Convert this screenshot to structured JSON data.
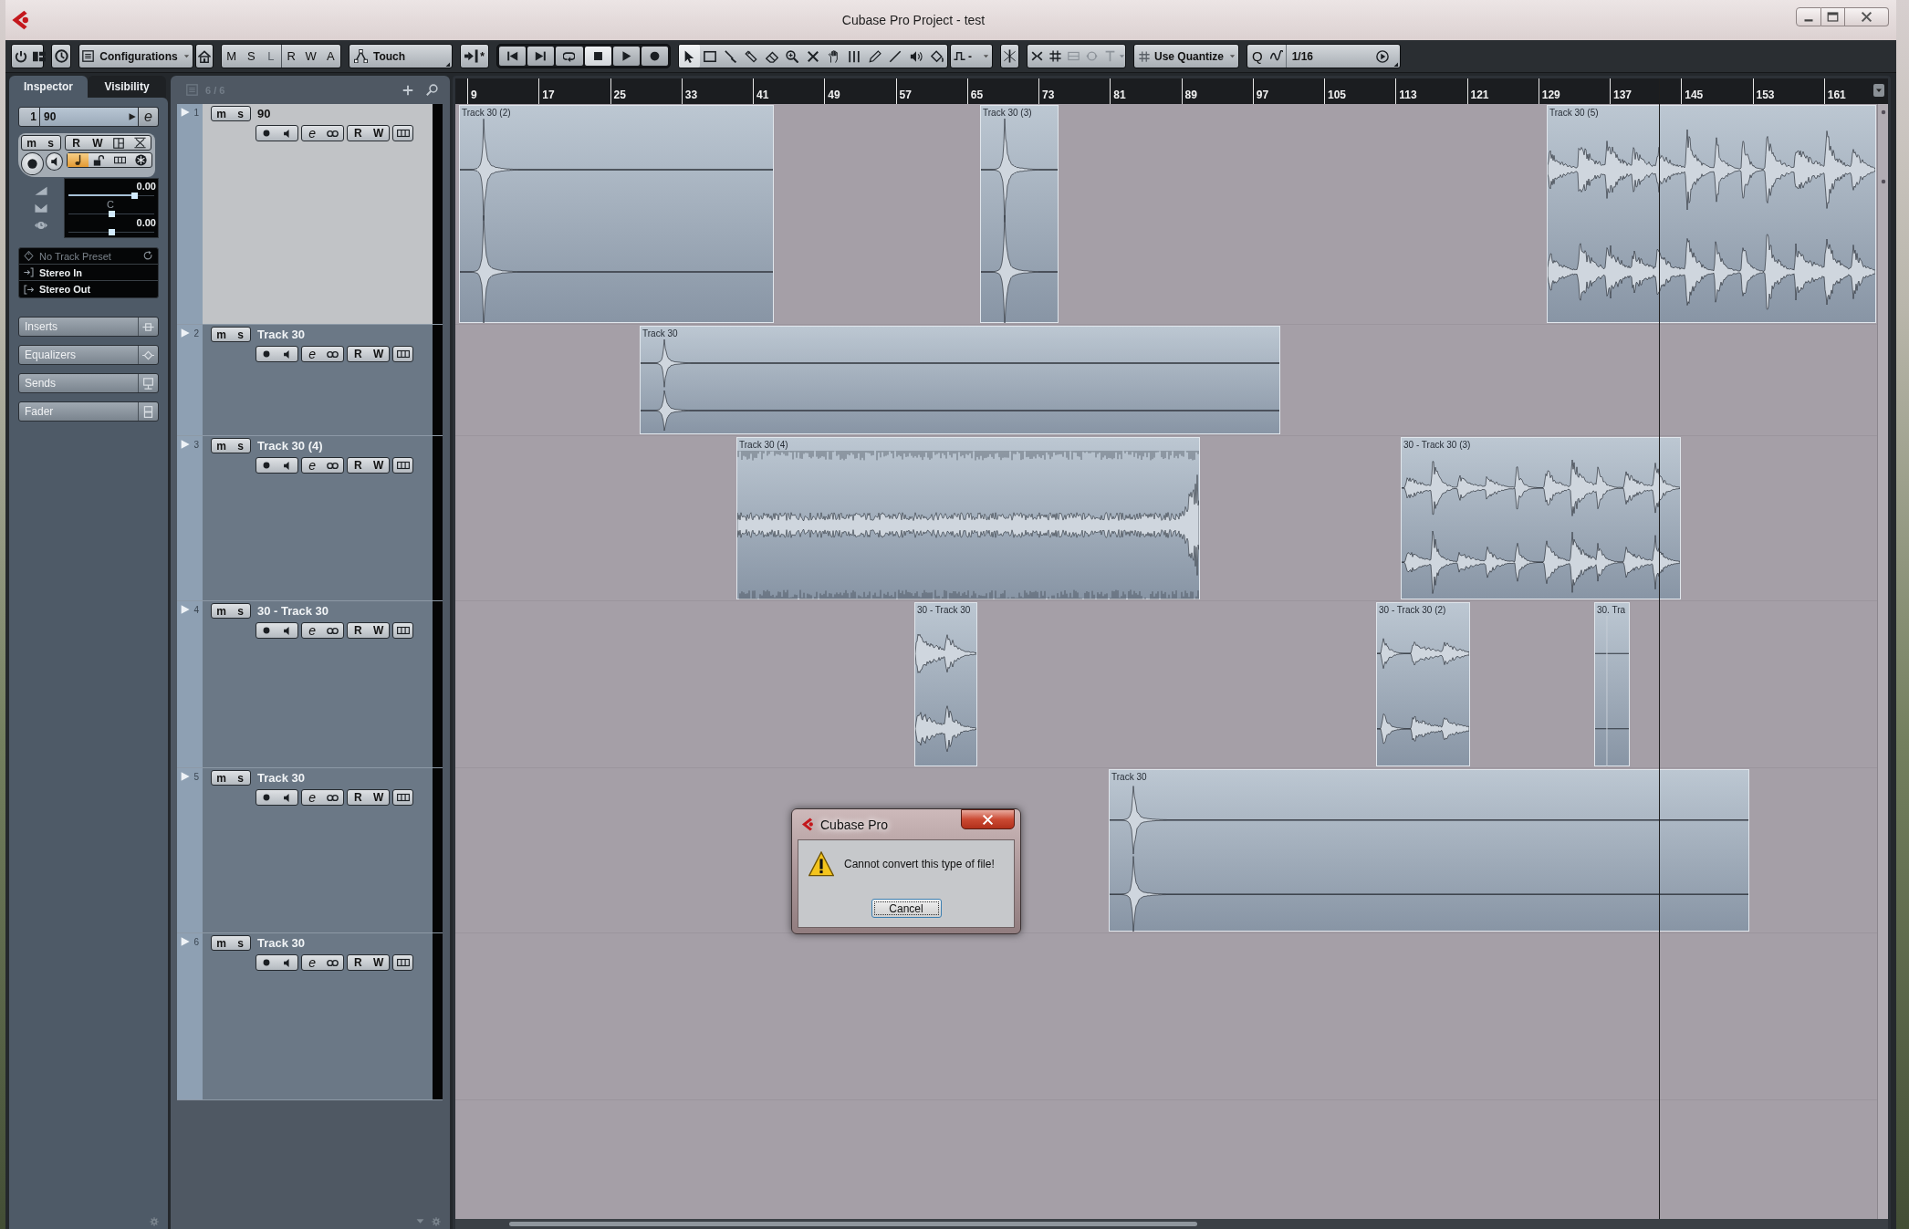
{
  "window": {
    "title": "Cubase Pro Project - test"
  },
  "toolbar": {
    "configurations": "Configurations",
    "global_buttons": [
      {
        "label": "M",
        "disabled": false
      },
      {
        "label": "S",
        "disabled": false
      },
      {
        "label": "L",
        "disabled": true
      },
      {
        "label": "R",
        "disabled": false
      },
      {
        "label": "W",
        "disabled": false
      },
      {
        "label": "A",
        "disabled": false
      }
    ],
    "automation_mode": "Touch",
    "snap_mark": "*",
    "transport": [
      {
        "on": false
      },
      {
        "on": false
      },
      {
        "on": false
      },
      {
        "on": true
      },
      {
        "on": false
      },
      {
        "on": false
      }
    ],
    "tools": [
      {
        "selected": true
      },
      {
        "selected": false
      },
      {
        "selected": false
      },
      {
        "selected": false
      },
      {
        "selected": false
      },
      {
        "selected": false
      },
      {
        "selected": false
      },
      {
        "selected": false
      },
      {
        "selected": false
      },
      {
        "selected": false
      },
      {
        "selected": false
      },
      {
        "selected": false
      },
      {
        "selected": false
      }
    ],
    "field_value": "-",
    "quantize_preset": "Use Quantize",
    "quantize_label": "Q",
    "quantize_value": "1/16"
  },
  "inspector": {
    "tabs": [
      {
        "label": "Inspector",
        "selected": true
      },
      {
        "label": "Visibility",
        "selected": false
      }
    ],
    "track_number": "1",
    "track_name": "90",
    "edit_label": "e",
    "mute_label": "m",
    "solo_label": "s",
    "read_label": "R",
    "write_label": "W",
    "toggles": [
      {
        "on": true
      },
      {
        "on": false
      },
      {
        "on": false
      },
      {
        "on": false
      }
    ],
    "controls": [
      {
        "kind": "volume",
        "reading": "0.00",
        "level": 0.77
      },
      {
        "kind": "pan",
        "reading": "C",
        "level": 0.5
      },
      {
        "kind": "delay",
        "reading": "0.00",
        "level": 0.5
      }
    ],
    "preset": "No Track Preset",
    "input": "Stereo In",
    "output": "Stereo Out",
    "sections": [
      "Inserts",
      "Equalizers",
      "Sends",
      "Fader"
    ]
  },
  "track_list": {
    "count": "6 / 6",
    "tracks": [
      {
        "number": "1",
        "name": "90",
        "selected": true,
        "mute_label": "m",
        "solo_label": "s",
        "edit_label": "e",
        "read_label": "R",
        "write_label": "W"
      },
      {
        "number": "2",
        "name": "Track 30",
        "selected": false,
        "mute_label": "m",
        "solo_label": "s",
        "edit_label": "e",
        "read_label": "R",
        "write_label": "W"
      },
      {
        "number": "3",
        "name": "Track 30 (4)",
        "selected": false,
        "mute_label": "m",
        "solo_label": "s",
        "edit_label": "e",
        "read_label": "R",
        "write_label": "W"
      },
      {
        "number": "4",
        "name": "30 - Track 30",
        "selected": false,
        "mute_label": "m",
        "solo_label": "s",
        "edit_label": "e",
        "read_label": "R",
        "write_label": "W"
      },
      {
        "number": "5",
        "name": "Track 30",
        "selected": false,
        "mute_label": "m",
        "solo_label": "s",
        "edit_label": "e",
        "read_label": "R",
        "write_label": "W"
      },
      {
        "number": "6",
        "name": "Track 30",
        "selected": false,
        "mute_label": "m",
        "solo_label": "s",
        "edit_label": "e",
        "read_label": "R",
        "write_label": "W"
      }
    ]
  },
  "arrange": {
    "ruler": [
      "9",
      "17",
      "25",
      "33",
      "41",
      "49",
      "57",
      "65",
      "73",
      "81",
      "89",
      "97",
      "105",
      "113",
      "121",
      "129",
      "137",
      "145",
      "153",
      "161"
    ],
    "lanes": [
      {
        "events": [
          {
            "name": "Track 30 (2)",
            "kind": "hit"
          },
          {
            "name": "Track 30 (3)",
            "kind": "hit"
          },
          {
            "name": "Track 30 (5)",
            "kind": "bursts"
          }
        ]
      },
      {
        "events": [
          {
            "name": "Track 30",
            "kind": "hit"
          }
        ]
      },
      {
        "events": [
          {
            "name": "Track 30 (4)",
            "kind": "noise"
          },
          {
            "name": "30 - Track 30 (3)",
            "kind": "bursts"
          }
        ]
      },
      {
        "events": [
          {
            "name": "30 - Track 30",
            "kind": "bursts"
          },
          {
            "name": "30 - Track 30 (2)",
            "kind": "bursts"
          },
          {
            "name": "30. Tra",
            "kind": "flat"
          }
        ]
      },
      {
        "events": [
          {
            "name": "Track 30",
            "kind": "hit"
          }
        ]
      }
    ]
  },
  "dialog": {
    "title": "Cubase Pro",
    "message": "Cannot convert this type of file!",
    "button": "Cancel"
  }
}
